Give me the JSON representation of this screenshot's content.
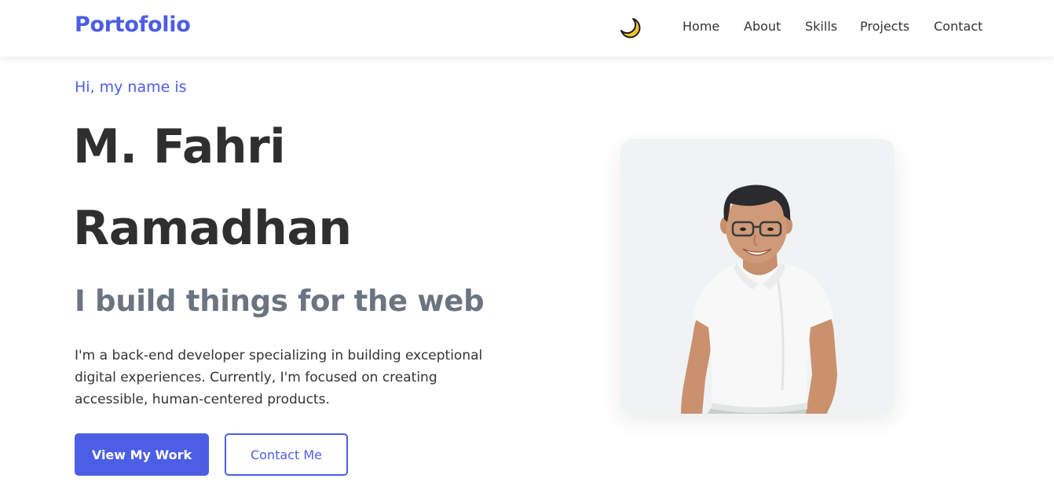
{
  "header": {
    "logo": "Portofolio",
    "theme_toggle_icon": "moon-icon",
    "nav": [
      {
        "label": "Home"
      },
      {
        "label": "About"
      },
      {
        "label": "Skills"
      },
      {
        "label": "Projects"
      },
      {
        "label": "Contact"
      }
    ]
  },
  "hero": {
    "greeting": "Hi, my name is",
    "name_line_1": "M. Fahri",
    "name_line_2": "Ramadhan",
    "tagline": "I build things for the web",
    "bio": "I'm a back-end developer specializing in building exceptional digital experiences. Currently, I'm focused on creating accessible, human-centered products.",
    "primary_button": "View My Work",
    "secondary_button": "Contact Me",
    "photo": "profile-photo"
  },
  "colors": {
    "accent": "#4b5ee4",
    "heading": "#2f2f2f",
    "tagline": "#6b7480",
    "photo_background": "#f0f3f3"
  }
}
